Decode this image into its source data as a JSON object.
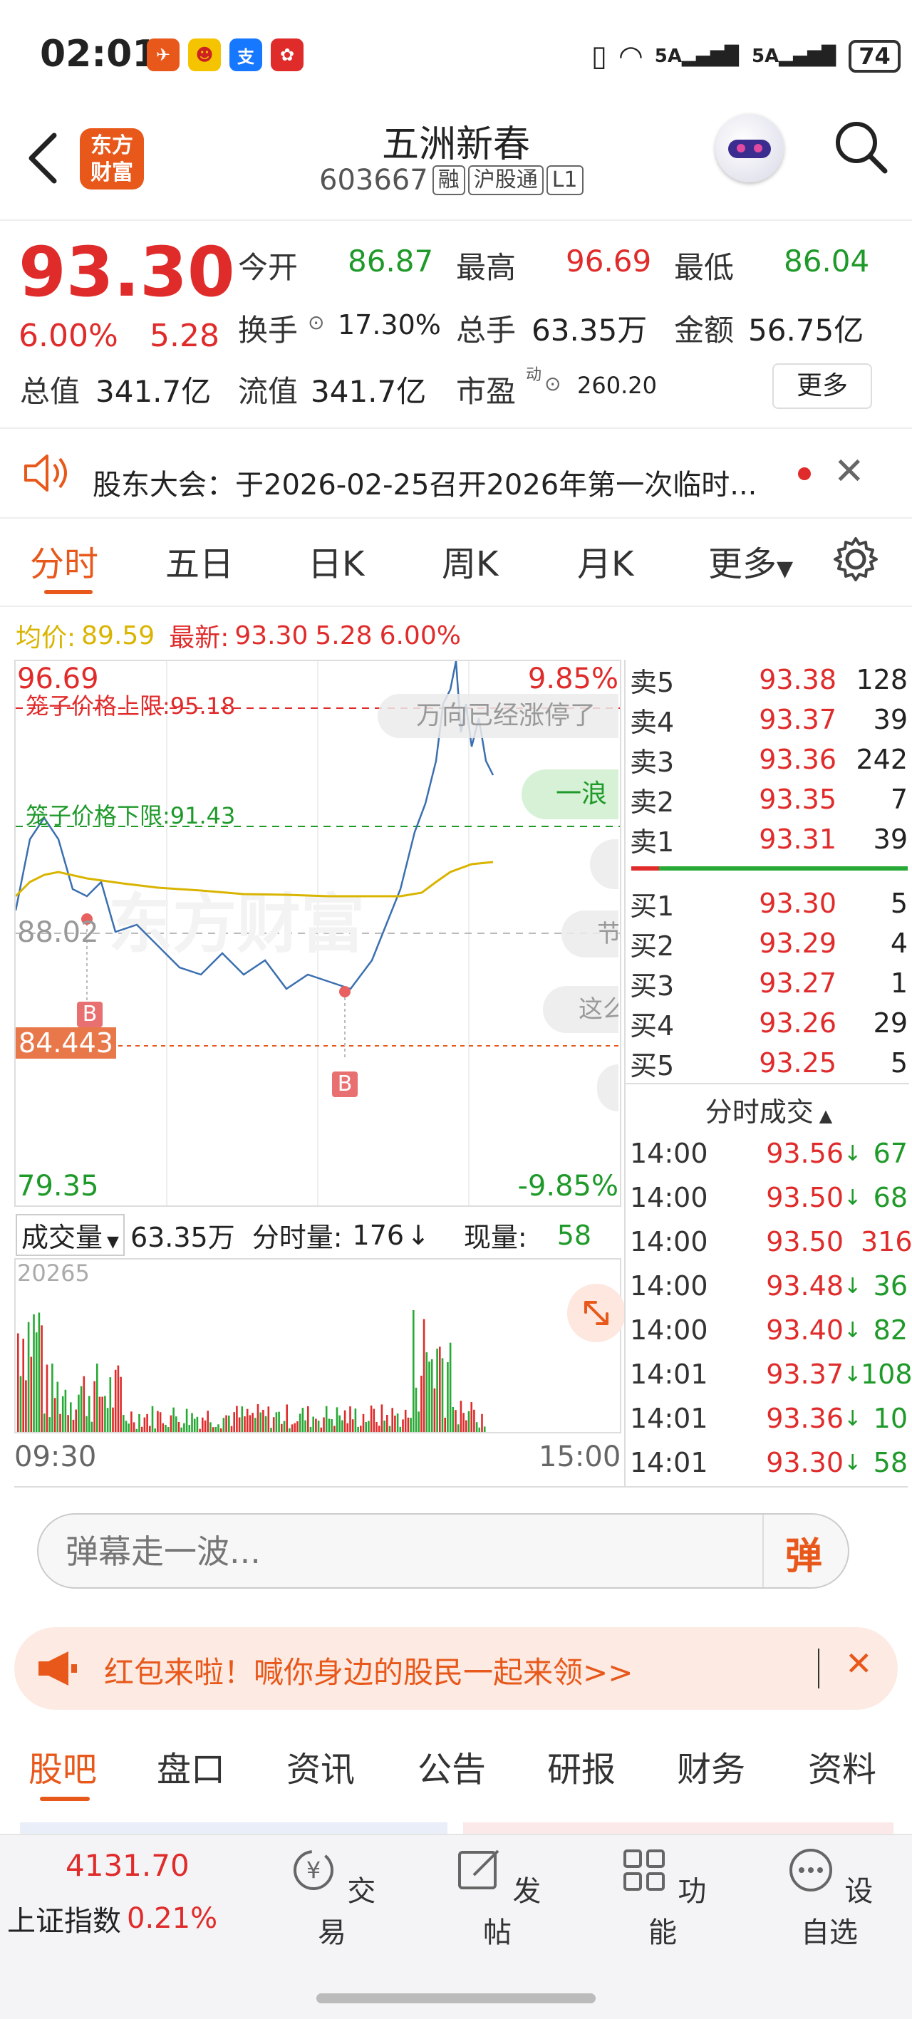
{
  "status_bar": {
    "time": "02:01",
    "battery": "74",
    "net1": "5A",
    "net2": "5A"
  },
  "header": {
    "title": "五洲新春",
    "code": "603667",
    "badges": [
      "融",
      "沪股通",
      "L1"
    ]
  },
  "quote": {
    "price": "93.30",
    "change_pct": "6.00%",
    "change": "5.28",
    "open_label": "今开",
    "open": "86.87",
    "high_label": "最高",
    "high": "96.69",
    "low_label": "最低",
    "low": "86.04",
    "turnover_label": "换手",
    "turnover": "17.30%",
    "volume_label": "总手",
    "volume": "63.35万",
    "amount_label": "金额",
    "amount": "56.75亿",
    "mktcap_label": "总值",
    "mktcap": "341.7亿",
    "float_label": "流值",
    "float": "341.7亿",
    "pe_label": "市盈",
    "pe_sup": "动",
    "pe": "260.20",
    "more_button": "更多"
  },
  "notice": {
    "text": "股东大会：于2026-02-25召开2026年第一次临时..."
  },
  "tabs": {
    "items": [
      "分时",
      "五日",
      "日K",
      "周K",
      "月K",
      "更多"
    ]
  },
  "chart_header": {
    "avg_label": "均价:",
    "avg": "89.59",
    "latest_label": "最新:",
    "latest": "93.30",
    "change": "5.28",
    "pct": "6.00%"
  },
  "chart_labels": {
    "top_price": "96.69",
    "top_pct": "9.85%",
    "mid_price": "88.02",
    "bottom_price": "79.35",
    "bottom_pct": "-9.85%",
    "cage_upper": "笼子价格上限:95.18",
    "cage_lower": "笼子价格下限:91.43",
    "marker_price": "84.443",
    "buy_marker": "B",
    "bubble1": "万向已经涨停了",
    "bubble2": "一浪",
    "bubble3": "节",
    "bubble4": "这么",
    "watermark": "东方财富"
  },
  "volume_bar": {
    "dropdown": "成交量",
    "total": "63.35万",
    "minute_label": "分时量:",
    "minute_value": "176",
    "current_label": "现量:",
    "current_value": "58",
    "max": "20265",
    "start_time": "09:30",
    "end_time": "15:00"
  },
  "orderbook": {
    "asks": [
      {
        "label": "卖5",
        "price": "93.38",
        "vol": "128"
      },
      {
        "label": "卖4",
        "price": "93.37",
        "vol": "39"
      },
      {
        "label": "卖3",
        "price": "93.36",
        "vol": "242"
      },
      {
        "label": "卖2",
        "price": "93.35",
        "vol": "7"
      },
      {
        "label": "卖1",
        "price": "93.31",
        "vol": "39"
      }
    ],
    "bids": [
      {
        "label": "买1",
        "price": "93.30",
        "vol": "5"
      },
      {
        "label": "买2",
        "price": "93.29",
        "vol": "4"
      },
      {
        "label": "买3",
        "price": "93.27",
        "vol": "1"
      },
      {
        "label": "买4",
        "price": "93.26",
        "vol": "29"
      },
      {
        "label": "买5",
        "price": "93.25",
        "vol": "5"
      }
    ]
  },
  "trades": {
    "title": "分时成交",
    "items": [
      {
        "time": "14:00",
        "price": "93.56",
        "dir": "↓",
        "vol": "67",
        "color": "green"
      },
      {
        "time": "14:00",
        "price": "93.50",
        "dir": "↓",
        "vol": "68",
        "color": "green"
      },
      {
        "time": "14:00",
        "price": "93.50",
        "dir": "",
        "vol": "316",
        "color": "red"
      },
      {
        "time": "14:00",
        "price": "93.48",
        "dir": "↓",
        "vol": "36",
        "color": "green"
      },
      {
        "time": "14:00",
        "price": "93.40",
        "dir": "↓",
        "vol": "82",
        "color": "green"
      },
      {
        "time": "14:01",
        "price": "93.37",
        "dir": "↓",
        "vol": "108",
        "color": "green"
      },
      {
        "time": "14:01",
        "price": "93.36",
        "dir": "↓",
        "vol": "10",
        "color": "green"
      },
      {
        "time": "14:01",
        "price": "93.30",
        "dir": "↓",
        "vol": "58",
        "color": "green"
      }
    ]
  },
  "danmaku": {
    "placeholder": "弹幕走一波...",
    "send": "弹"
  },
  "banner": {
    "text": "红包来啦！喊你身边的股民一起来领>>"
  },
  "bottom_tabs": {
    "items": [
      "股吧",
      "盘口",
      "资讯",
      "公告",
      "研报",
      "财务",
      "资料"
    ]
  },
  "bottom_nav": {
    "index_value": "4131.70",
    "index_name": "上证指数",
    "index_pct": "0.21%",
    "trade": "交易",
    "post": "发帖",
    "func": "功能",
    "watch": "设自选"
  },
  "colors": {
    "up": "#e02b2b",
    "down": "#1f9a2a",
    "accent": "#e8581b",
    "avg_line": "#d9b400",
    "price_line": "#3b6fb0"
  }
}
